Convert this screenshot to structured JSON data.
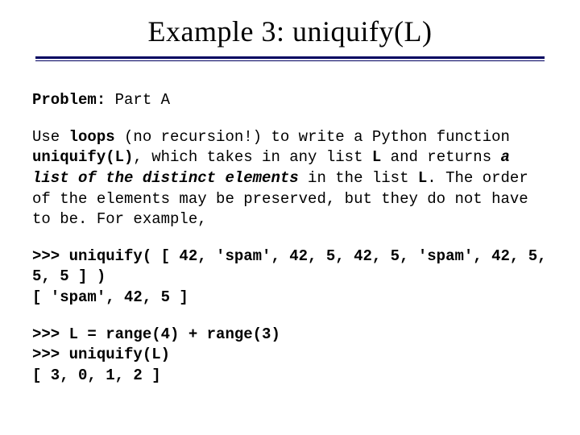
{
  "title": "Example 3: uniquify(L)",
  "problem_label": "Problem:",
  "problem_part": " Part A",
  "p1_a": "Use ",
  "p1_b": "loops",
  "p1_c": " (no recursion!) to write a Python function ",
  "p1_d": "uniquify(L)",
  "p1_e": ", which takes in any list ",
  "p1_f": "L",
  "p1_g": " and returns ",
  "p1_h": "a list of the distinct elements",
  "p1_i": " in the list ",
  "p1_j": "L",
  "p1_k": ".  The order of the elements may be preserved, but they do not have to be. For example,",
  "ex1_l1": ">>> uniquify( [ 42, 'spam', 42, 5, 42, 5, 'spam', 42, 5, 5, 5 ] )",
  "ex1_l2": "[ 'spam', 42, 5 ]",
  "ex2_l1": ">>> L = range(4) + range(3)",
  "ex2_l2": ">>> uniquify(L)",
  "ex2_l3": "[ 3, 0, 1, 2 ]"
}
